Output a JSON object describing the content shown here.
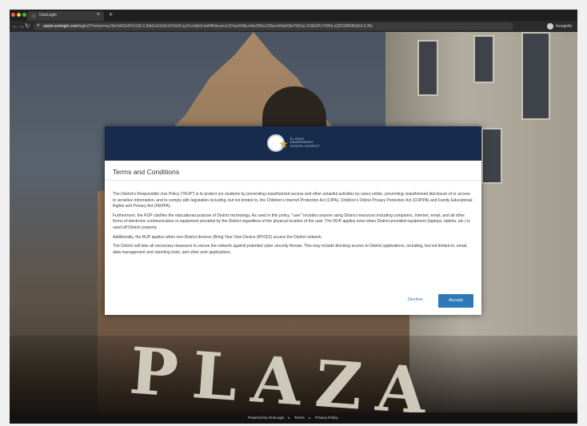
{
  "browser": {
    "tab_title": "OneLogin",
    "tab_close": "×",
    "new_tab": "+",
    "url_host": "episd.onelogin.com",
    "url_path": "/login2/?return=eyJ0eXAiOiJKV1QiLCJhbGciOiJIUzI1NiJ9.eyJ1cmkiOiJodHRwczovL2VwaXNkLm9uZWxvZ2luLmNvbS9zYW1sL21ldGFkYXRhLzQ5ODM3NzEiLCJ0c",
    "profile_label": "Incognito",
    "back_icon": "←",
    "forward_icon": "→",
    "reload_icon": "↻",
    "lock_icon": "🔒"
  },
  "modal": {
    "logo_text_lines": [
      "EL PASO",
      "INDEPENDENT",
      "SCHOOL DISTRICT"
    ],
    "title": "Terms and Conditions",
    "paragraphs": [
      "The District's Responsible Use Policy (\"RUP\") is to protect our students by preventing unauthorized access and other unlawful activities by users online, preventing unauthorized disclosure of or access to sensitive information, and to comply with legislation including, but not limited to, the Children's Internet Protection Act (CIPA), Children's Online Privacy Protection Act (COPPA) and Family Educational Rights and Privacy Act (FERPA).",
      "Furthermore, the RUP clarifies the educational purpose of District technology. As used in this policy, \"user\" includes anyone using District resources including computers, Internet, email, and all other forms of electronic communication or equipment provided by the District regardless of the physical location of the user. The RUP applies even when District-provided equipment (laptops, tablets, etc.) is used off District property.",
      "Additionally, the RUP applies when non-District devices (Bring Your Own Device (BYOD)) access the District network.",
      "The District will take all necessary measures to secure the network against potential cyber security threats. This may include blocking access to District applications, including, but not limited to, email, data management and reporting tools, and other web applications."
    ],
    "decline_label": "Decline",
    "accept_label": "Accept"
  },
  "footer": {
    "powered_by": "Powered by OneLogin",
    "terms": "Terms",
    "privacy": "Privacy Policy"
  },
  "colors": {
    "header_navy": "#172c4d",
    "accept_blue": "#2f79b8",
    "link_blue": "#2f6fb6"
  }
}
